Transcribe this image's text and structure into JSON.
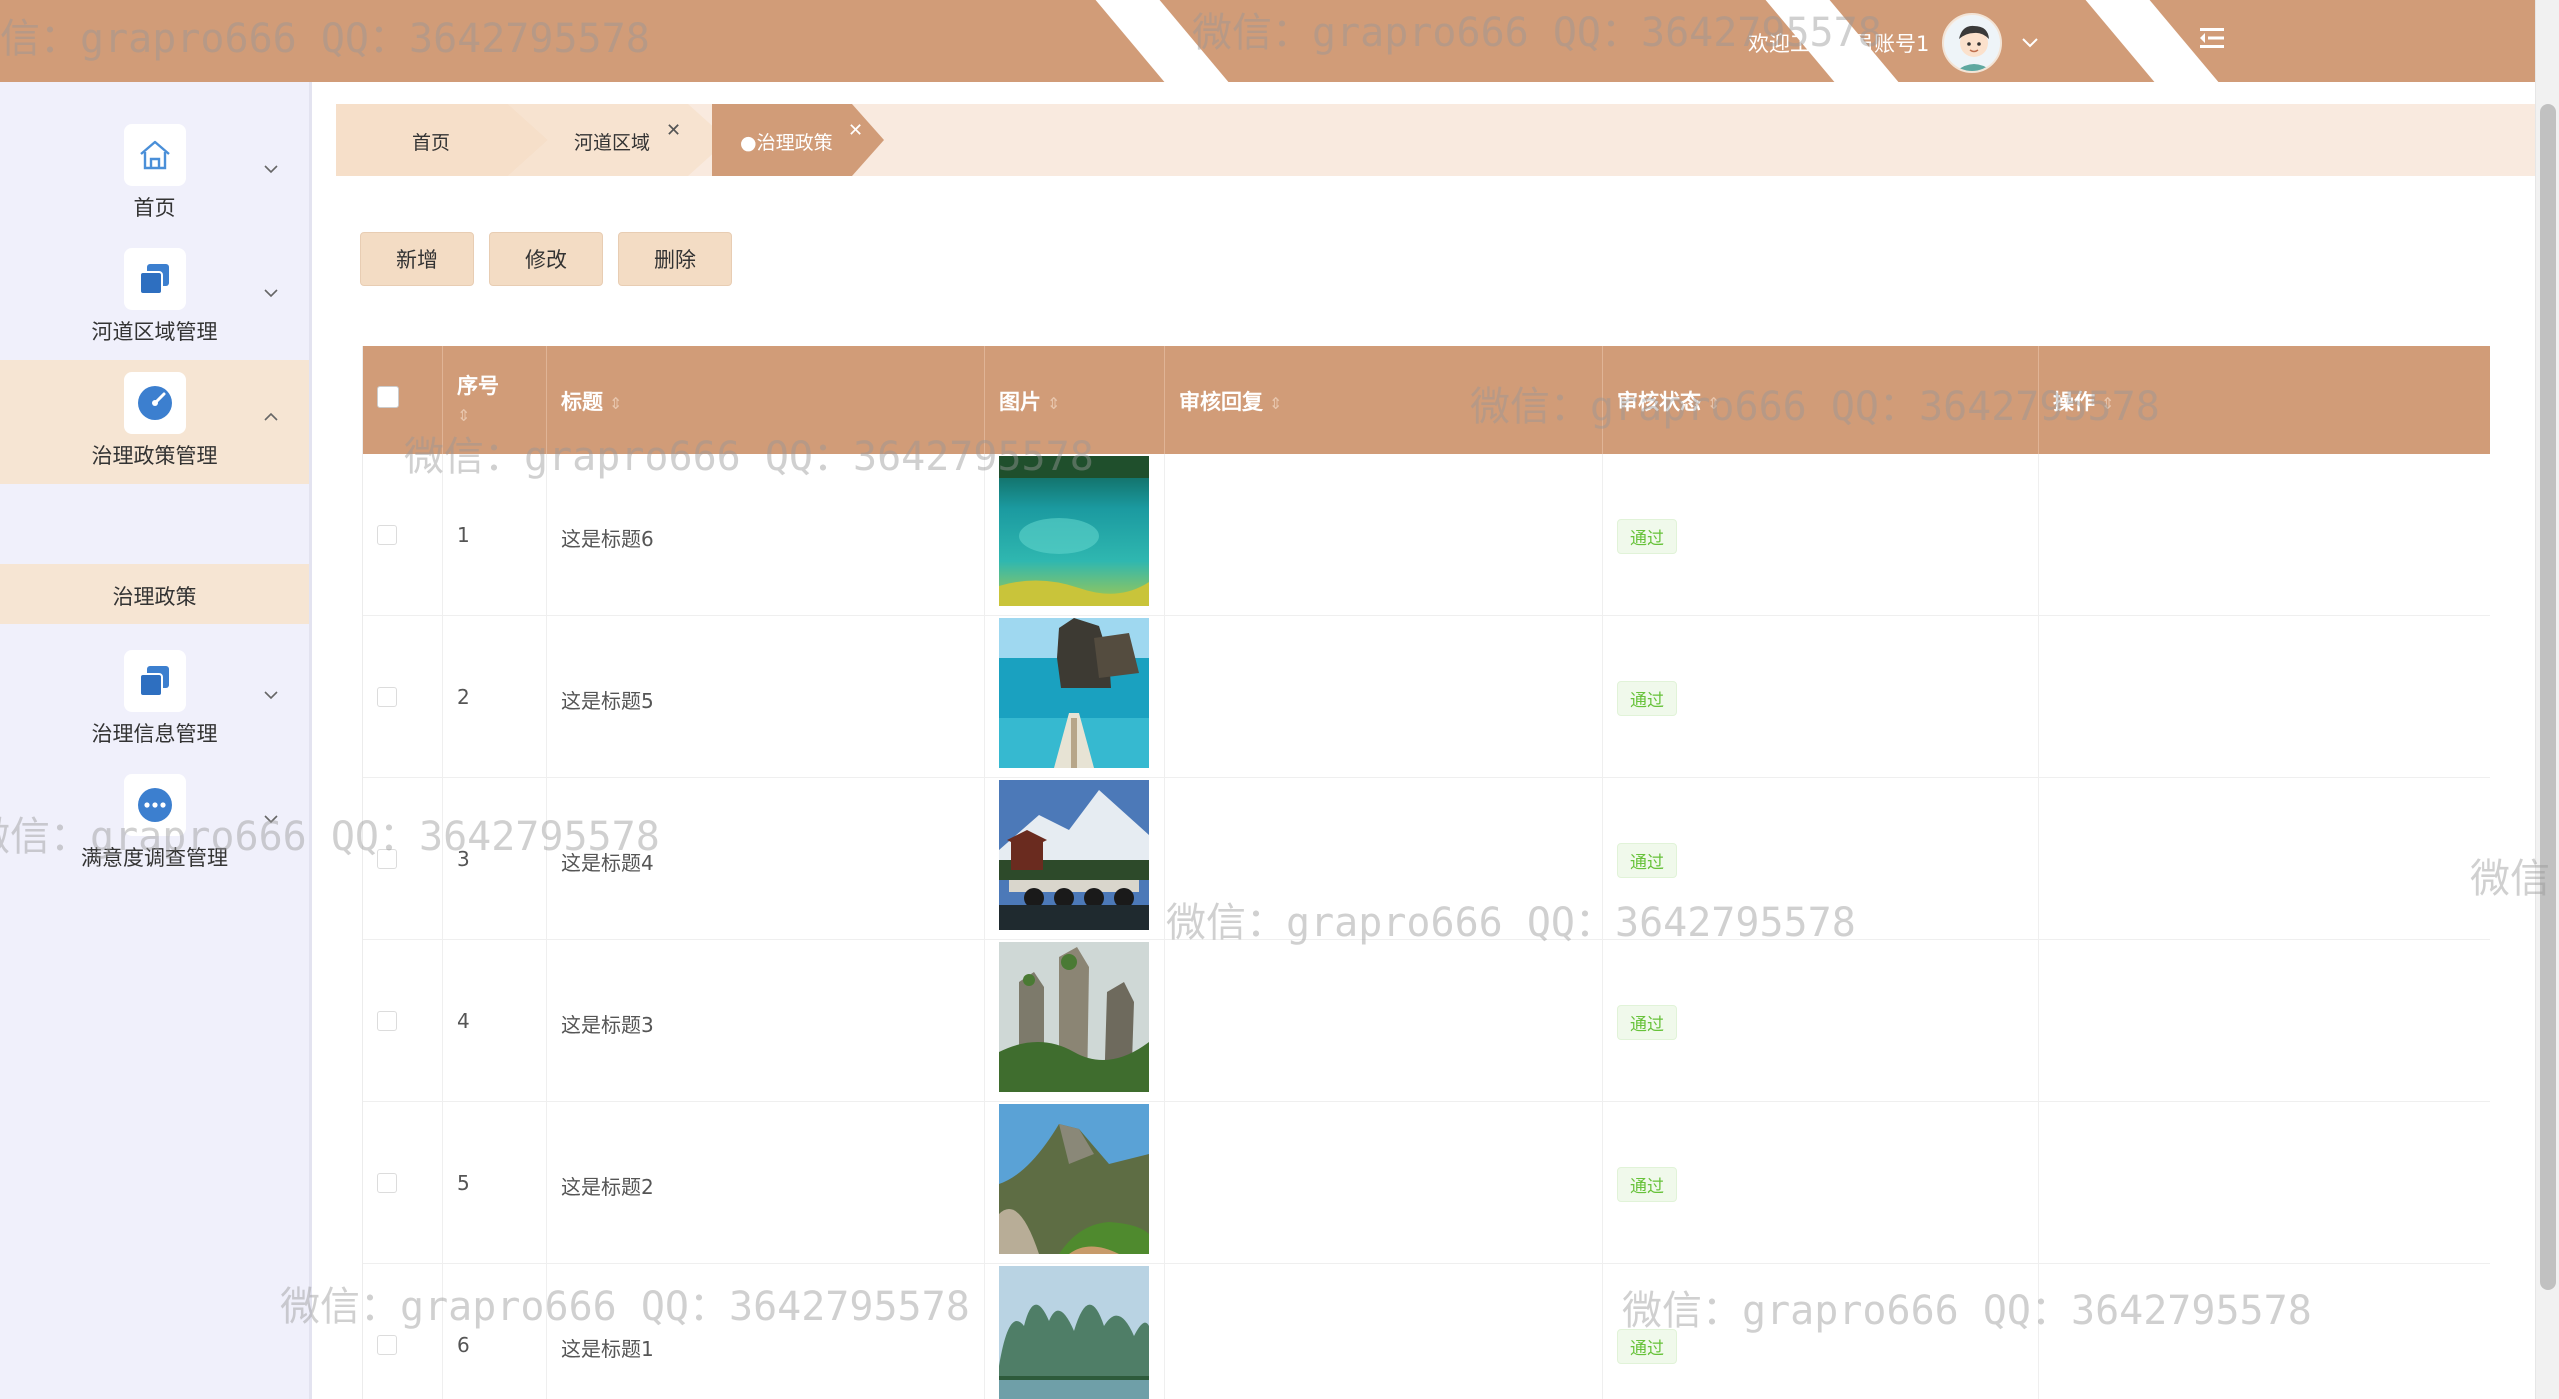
{
  "header": {
    "welcome_text": "欢迎工作人员账号1",
    "avatar": "avatar-icon",
    "menu_toggle": "menu-fold-icon",
    "color": "#d19c78"
  },
  "sidebar": {
    "items": [
      {
        "label": "首页",
        "icon": "home-icon",
        "expanded": false
      },
      {
        "label": "河道区域管理",
        "icon": "copy-icon",
        "expanded": false
      },
      {
        "label": "治理政策管理",
        "icon": "gauge-icon",
        "expanded": true
      },
      {
        "label": "治理信息管理",
        "icon": "copy-icon",
        "expanded": false
      },
      {
        "label": "满意度调查管理",
        "icon": "ellipsis-icon",
        "expanded": false
      }
    ],
    "submenu": {
      "label": "治理政策"
    }
  },
  "tabs": [
    {
      "label": "首页",
      "closable": false,
      "active": false
    },
    {
      "label": "河道区域",
      "closable": true,
      "active": false
    },
    {
      "label": "●治理政策",
      "closable": true,
      "active": true
    }
  ],
  "toolbar": {
    "add_label": "新增",
    "edit_label": "修改",
    "delete_label": "删除"
  },
  "table": {
    "columns": [
      {
        "label": ""
      },
      {
        "label": "序号",
        "sortable": true
      },
      {
        "label": "标题",
        "sortable": true
      },
      {
        "label": "图片",
        "sortable": true
      },
      {
        "label": "审核回复",
        "sortable": true
      },
      {
        "label": "审核状态",
        "sortable": true
      },
      {
        "label": "操作",
        "sortable": true
      }
    ],
    "sort_glyph": "⇕",
    "rows": [
      {
        "index": "1",
        "title": "这是标题6",
        "image": "lake-photo",
        "reply": "",
        "status": "通过"
      },
      {
        "index": "2",
        "title": "这是标题5",
        "image": "sea-cliff-photo",
        "reply": "",
        "status": "通过"
      },
      {
        "index": "3",
        "title": "这是标题4",
        "image": "snow-mountain-bridge-photo",
        "reply": "",
        "status": "通过"
      },
      {
        "index": "4",
        "title": "这是标题3",
        "image": "stone-pillars-photo",
        "reply": "",
        "status": "通过"
      },
      {
        "index": "5",
        "title": "这是标题2",
        "image": "rock-mountain-photo",
        "reply": "",
        "status": "通过"
      },
      {
        "index": "6",
        "title": "这是标题1",
        "image": "karst-river-photo",
        "reply": "",
        "status": "通过"
      }
    ]
  },
  "watermark_text": "微信：grapro666 QQ：3642795578",
  "watermark_partial": "微信"
}
